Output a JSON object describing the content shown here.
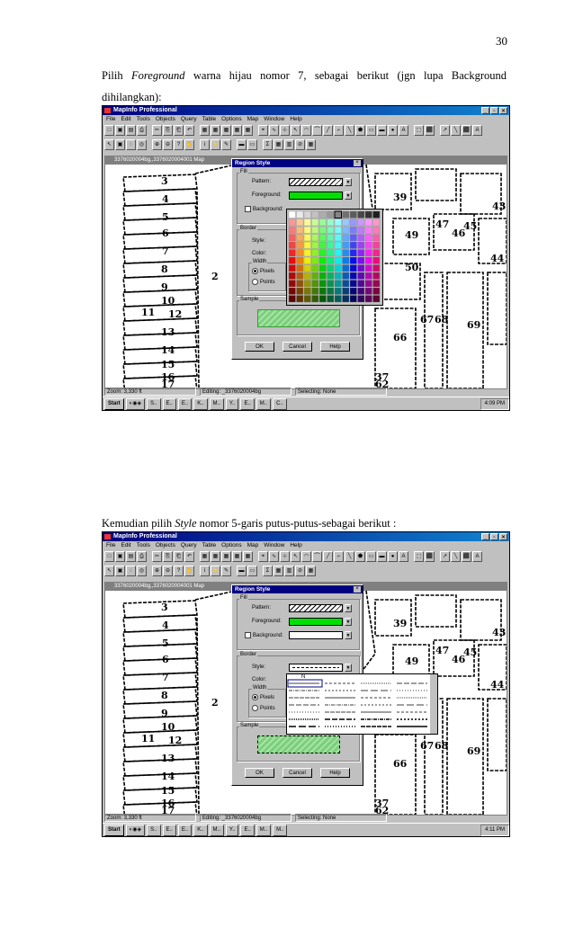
{
  "page_number": "30",
  "paragraph1": {
    "line1_a": "Pilih ",
    "line1_em": "Foreground",
    "line1_b": " warna hijau nomor 7, sebagai berikut (jgn lupa Background",
    "line2": "dihilangkan):"
  },
  "paragraph2": {
    "a": "Kemudian pilih ",
    "em": "Style",
    "b": " nomor 5-garis putus-putus-sebagai berikut :"
  },
  "app": {
    "title": "MapInfo Professional",
    "menus": [
      "File",
      "Edit",
      "Tools",
      "Objects",
      "Query",
      "Table",
      "Options",
      "Map",
      "Window",
      "Help"
    ],
    "map_window_title": "3376020004bg,,3376020004001 Map",
    "status_zoom": "Zoom: 3,330 ft",
    "status_editing": "Editing: _3376020004bg",
    "status_selecting": "Selecting: None",
    "start_label": "Start",
    "task_items": [
      "S..",
      "E..",
      "E..",
      "K..",
      "M..",
      "Y..",
      "E..",
      "M..",
      "M..",
      "C.."
    ],
    "colors": {
      "title_start": "#000080",
      "title_end": "#1084d0",
      "foreground_green": "#00e000"
    }
  },
  "dialog": {
    "title": "Region Style",
    "fill_label": "Fill",
    "pattern_label": "Pattern:",
    "foreground_label": "Foreground:",
    "background_label": "Background:",
    "border_label": "Border",
    "style_label": "Style:",
    "color_label": "Color:",
    "width_label": "Width",
    "pixels_label": "Pixels",
    "points_label": "Points",
    "sample_label": "Sample",
    "ok": "OK",
    "cancel": "Cancel",
    "help": "Help",
    "style_none_label": "N"
  },
  "shot1": {
    "clock": "4:09 PM"
  },
  "shot2": {
    "clock": "4:11 PM"
  },
  "map_labels": [
    "3",
    "4",
    "5",
    "6",
    "7",
    "8",
    "9",
    "10",
    "11",
    "12",
    "13",
    "14",
    "15",
    "16",
    "17",
    "2",
    "39",
    "49",
    "47",
    "46",
    "45",
    "43",
    "44",
    "50",
    "69",
    "66",
    "67",
    "68",
    "62",
    "37"
  ]
}
